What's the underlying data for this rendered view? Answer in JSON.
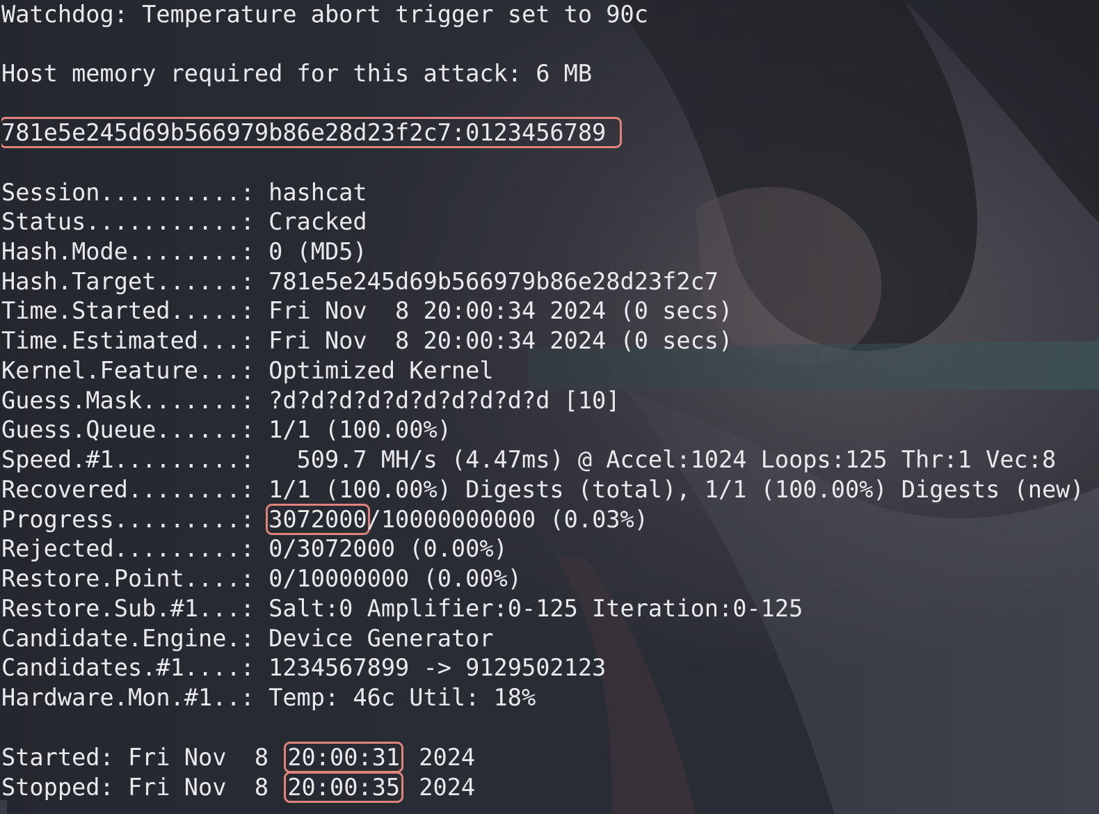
{
  "terminal": {
    "watchdog": "Watchdog: Temperature abort trigger set to 90c",
    "memory": "Host memory required for this attack: 6 MB",
    "cracked": "781e5e245d69b566979b86e28d23f2c7:0123456789",
    "status_lines": [
      "Session..........: hashcat",
      "Status...........: Cracked",
      "Hash.Mode........: 0 (MD5)",
      "Hash.Target......: 781e5e245d69b566979b86e28d23f2c7",
      "Time.Started.....: Fri Nov  8 20:00:34 2024 (0 secs)",
      "Time.Estimated...: Fri Nov  8 20:00:34 2024 (0 secs)",
      "Kernel.Feature...: Optimized Kernel",
      "Guess.Mask.......: ?d?d?d?d?d?d?d?d?d?d [10]",
      "Guess.Queue......: 1/1 (100.00%)",
      "Speed.#1.........:   509.7 MH/s (4.47ms) @ Accel:1024 Loops:125 Thr:1 Vec:8",
      "Recovered........: 1/1 (100.00%) Digests (total), 1/1 (100.00%) Digests (new)"
    ],
    "progress": {
      "label": "Progress.........: ",
      "value": "3072000",
      "rest": "/10000000000 (0.03%)"
    },
    "status_lines_2": [
      "Rejected.........: 0/3072000 (0.00%)",
      "Restore.Point....: 0/10000000 (0.00%)",
      "Restore.Sub.#1...: Salt:0 Amplifier:0-125 Iteration:0-125",
      "Candidate.Engine.: Device Generator",
      "Candidates.#1....: 1234567899 -> 9129502123",
      "Hardware.Mon.#1..: Temp: 46c Util: 18%"
    ],
    "started": {
      "prefix": "Started: Fri Nov  8 ",
      "time": "20:00:31",
      "suffix": " 2024"
    },
    "stopped": {
      "prefix": "Stopped: Fri Nov  8 ",
      "time": "20:00:35",
      "suffix": " 2024"
    }
  },
  "colors": {
    "background": "#2a2c33",
    "text": "#e9eaee",
    "highlight_border": "#e0837c"
  }
}
